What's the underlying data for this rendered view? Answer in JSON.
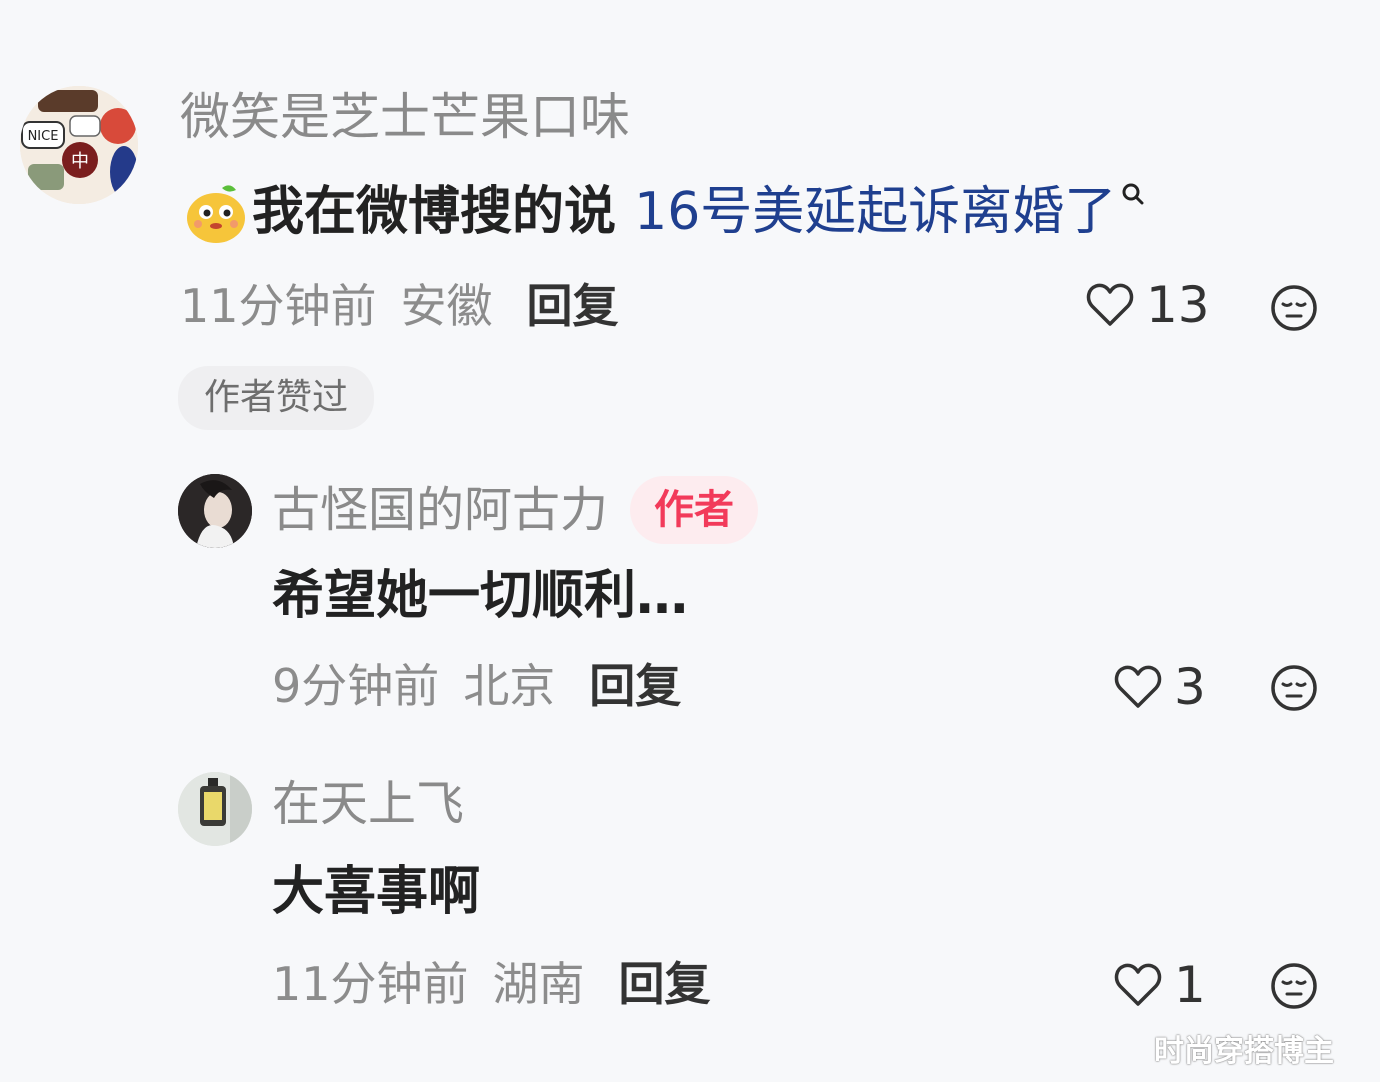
{
  "comments": [
    {
      "username": "微笑是芝士芒果口味",
      "content_prefix": "我在微博搜的说 ",
      "content_link": "16号美延起诉离婚了",
      "time": "11分钟前",
      "location": "安徽",
      "reply_label": "回复",
      "likes": "13",
      "badge": "作者赞过"
    },
    {
      "username": "古怪国的阿古力",
      "author_tag": "作者",
      "content": "希望她一切顺利…",
      "time": "9分钟前",
      "location": "北京",
      "reply_label": "回复",
      "likes": "3"
    },
    {
      "username": "在天上飞",
      "content": "大喜事啊",
      "time": "11分钟前",
      "location": "湖南",
      "reply_label": "回复",
      "likes": "1"
    }
  ],
  "avatar1_labels": [
    "NICE",
    "中"
  ],
  "icons": {
    "like": "heart-outline-icon",
    "dislike": "neutral-face-icon",
    "search": "search-icon",
    "emoji": "mango-face-emoji-icon"
  },
  "colors": {
    "background": "#f7f8fa",
    "author_tag": "#f23a5a",
    "link": "#1f3f8f"
  },
  "watermark": "时尚穿搭博主"
}
